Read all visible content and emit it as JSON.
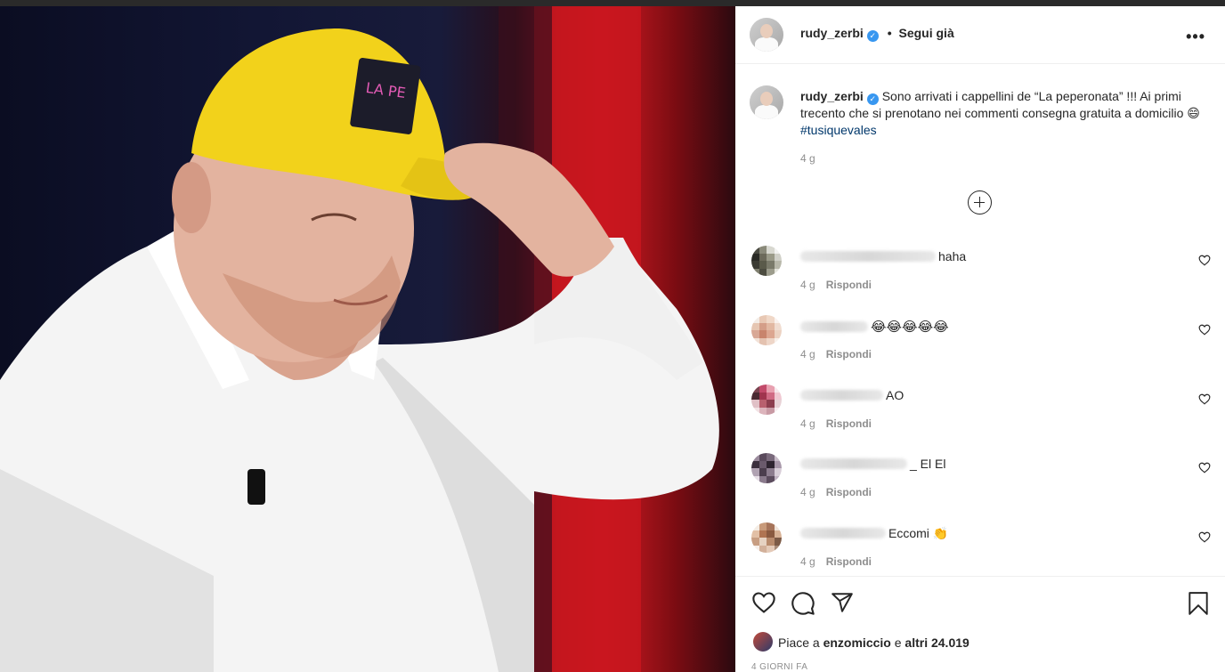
{
  "post": {
    "username": "rudy_zerbi",
    "follow_label": "Segui già",
    "more_label": "•••",
    "caption_text": "Sono arrivati i cappellini de “La peperonata” !!! Ai primi trecento che si prenotano nei commenti consegna gratuita a domicilio 😄",
    "hashtag": "#tusiquevales",
    "caption_time": "4 g",
    "photo_alt": "man in yellow cap"
  },
  "comments": [
    {
      "username_hidden": true,
      "text": "haha",
      "time": "4 g",
      "reply_label": "Rispondi"
    },
    {
      "username_hidden": true,
      "text": "😂😂😂😂😂",
      "time": "4 g",
      "reply_label": "Rispondi"
    },
    {
      "username_hidden": true,
      "text": "AO",
      "time": "4 g",
      "reply_label": "Rispondi"
    },
    {
      "username_hidden": true,
      "text": "_ El El",
      "time": "4 g",
      "reply_label": "Rispondi"
    },
    {
      "username_hidden": true,
      "text": "Eccomi 👏",
      "time": "4 g",
      "reply_label": "Rispondi"
    }
  ],
  "likes": {
    "prefix": "Piace a",
    "user": "enzomiccio",
    "middle": "e",
    "others": "altri 24.019"
  },
  "date_label": "4 GIORNI FA",
  "icons": {
    "like": "heart-icon",
    "comment": "comment-icon",
    "share": "paper-plane-icon",
    "save": "bookmark-icon",
    "load_more": "plus-circle-icon",
    "verified": "verified-badge-icon"
  },
  "colors": {
    "verified": "#3897f0",
    "hashtag": "#00376b",
    "muted": "#8e8e8e",
    "cap": "#f2d21b",
    "shirt": "#f4f4f4"
  }
}
